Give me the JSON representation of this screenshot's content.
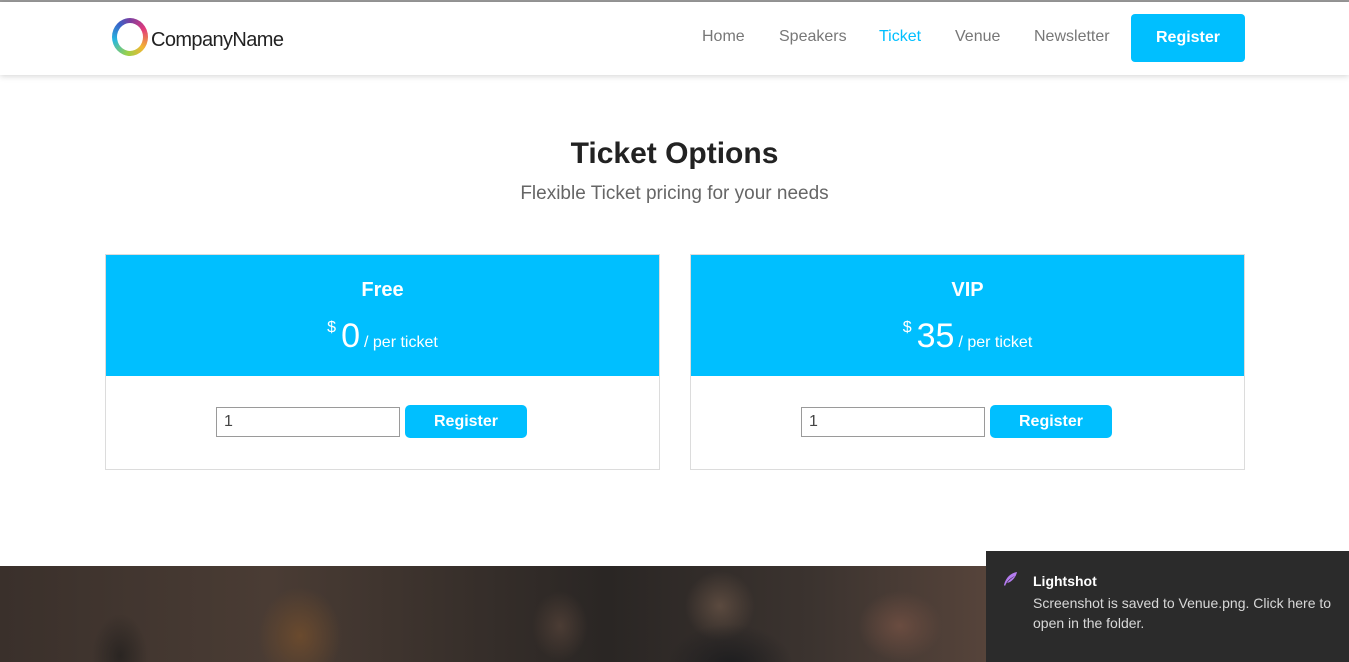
{
  "brand": {
    "name": "CompanyName",
    "logo_icon": "ring-logo-icon"
  },
  "nav": {
    "items": [
      {
        "label": "Home",
        "active": false
      },
      {
        "label": "Speakers",
        "active": false
      },
      {
        "label": "Ticket",
        "active": true
      },
      {
        "label": "Venue",
        "active": false
      },
      {
        "label": "Newsletter",
        "active": false
      }
    ],
    "register_label": "Register"
  },
  "section": {
    "title": "Ticket Options",
    "subtitle": "Flexible Ticket pricing for your needs"
  },
  "tickets": [
    {
      "name": "Free",
      "currency": "$",
      "amount": "0",
      "per": "/ per ticket",
      "quantity": "1",
      "button_label": "Register"
    },
    {
      "name": "VIP",
      "currency": "$",
      "amount": "35",
      "per": "/ per ticket",
      "quantity": "1",
      "button_label": "Register"
    }
  ],
  "toast": {
    "app": "Lightshot",
    "message": "Screenshot is saved to Venue.png. Click here to open in the folder.",
    "icon": "feather-icon"
  },
  "colors": {
    "accent": "#00bfff",
    "toast_bg": "#2b2b2b",
    "nav_text": "#777777"
  }
}
